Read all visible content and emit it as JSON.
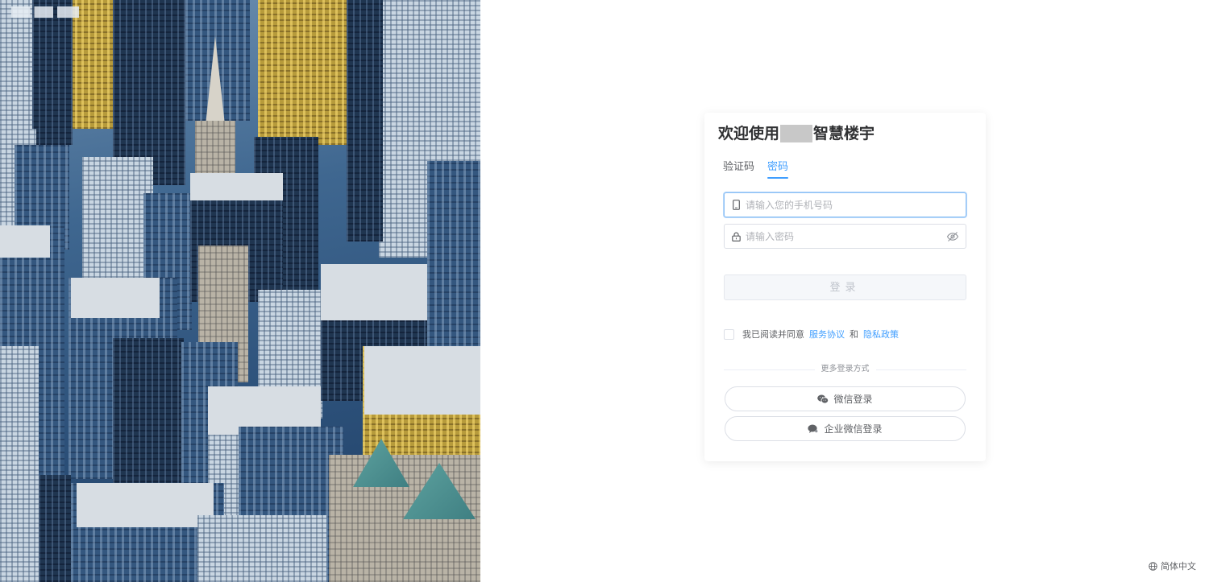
{
  "login": {
    "title_prefix": "欢迎使用",
    "title_suffix": "智慧楼宇",
    "tabs": [
      {
        "label": "验证码",
        "active": false
      },
      {
        "label": "密码",
        "active": true
      }
    ],
    "phone_placeholder": "请输入您的手机号码",
    "password_placeholder": "请输入密码",
    "submit_label": "登录",
    "agreement": {
      "prefix": "我已阅读并同意",
      "service_link": "服务协议",
      "conjunction": "和",
      "privacy_link": "隐私政策"
    },
    "more_methods": "更多登录方式",
    "wechat_label": "微信登录",
    "wecom_label": "企业微信登录"
  },
  "footer": {
    "language_label": "简体中文"
  },
  "icons": {
    "phone": "phone-icon",
    "lock": "lock-icon",
    "eye_hidden": "eye-off-icon",
    "wechat": "wechat-icon",
    "wecom": "wecom-icon",
    "globe": "globe-icon"
  },
  "colors": {
    "accent": "#409eff",
    "border": "#dcdfe6",
    "placeholder": "#b1b3b8"
  }
}
